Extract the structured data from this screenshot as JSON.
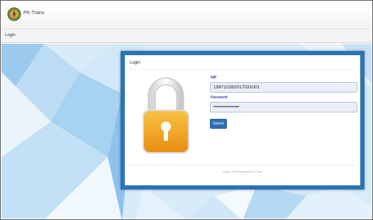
{
  "header": {
    "app_title": "PK-Trans"
  },
  "nav": {
    "login_label": "Login"
  },
  "login_dialog": {
    "title": "Login",
    "nip_label": "NIP",
    "nip_value": "198710262017031001",
    "password_label": "Password",
    "password_value": "••••••••••••••••",
    "submit_label": "Submit",
    "footer_text": "Copy © 2018 Powered by PK-Trans"
  },
  "colors": {
    "dialog_border": "#2b73b4",
    "submit_bg": "#2f6fb5",
    "label_color": "#2d3bb0",
    "lock_body": "#f3a21c"
  },
  "icons": {
    "logo": "app-logo-icon",
    "lock": "padlock-icon"
  }
}
